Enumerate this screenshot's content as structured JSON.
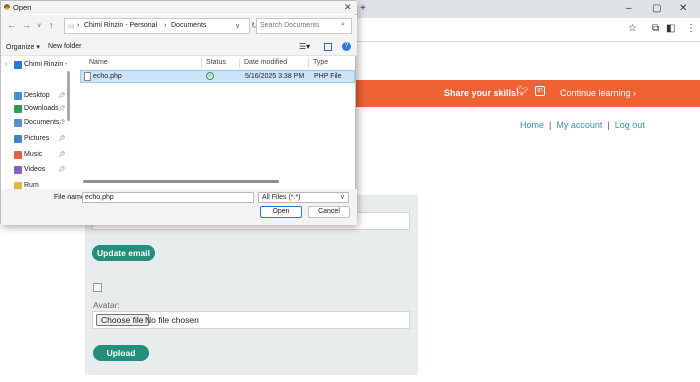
{
  "website": {
    "banner": {
      "text": "Share your skills!",
      "twitter_icon": "twitter-icon",
      "linkedin_icon": "linkedin-icon",
      "linkedin_glyph": "in",
      "continue": "Continue learning ›"
    },
    "nav": {
      "home": "Home",
      "sep": "|",
      "account": "My account",
      "logout": "Log out"
    },
    "update_email_button": "Update email",
    "avatar_label": "Avatar:",
    "choose_file_button": "Choose file",
    "no_file_text": "No file chosen",
    "upload_button": "Upload"
  },
  "dialog": {
    "title": "Open",
    "address": {
      "root": "Chimi Rinzin - Personal",
      "folder": "Documents"
    },
    "search_placeholder": "Search Documents",
    "organize": "Organize ▾",
    "new_folder": "New folder",
    "nav_pane": [
      {
        "label": "Chimi Rinzin - Pe",
        "icon": "cloud-icon",
        "color": "#2a7ad5",
        "pinned": false
      },
      {
        "label": "Desktop",
        "icon": "desktop-icon",
        "color": "#3b8fd6",
        "pinned": true
      },
      {
        "label": "Downloads",
        "icon": "downloads-icon",
        "color": "#2f9a5a",
        "pinned": true
      },
      {
        "label": "Documents",
        "icon": "documents-icon",
        "color": "#5a8fc7",
        "pinned": true
      },
      {
        "label": "Pictures",
        "icon": "pictures-icon",
        "color": "#3f86c9",
        "pinned": true
      },
      {
        "label": "Music",
        "icon": "music-icon",
        "color": "#e0644a",
        "pinned": true
      },
      {
        "label": "Videos",
        "icon": "videos-icon",
        "color": "#8b5cc7",
        "pinned": true
      },
      {
        "label": "Rum",
        "icon": "folder-icon",
        "color": "#e8b640",
        "pinned": false
      }
    ],
    "columns": {
      "name": "Name",
      "status": "Status",
      "date": "Date modified",
      "type": "Type"
    },
    "files": [
      {
        "name": "echo.php",
        "date": "5/16/2025 3:38 PM",
        "type": "PHP File"
      }
    ],
    "file_name_label": "File name:",
    "file_name_value": "echo.php",
    "file_type": "All Files (*.*)",
    "open_button": "Open",
    "cancel_button": "Cancel"
  }
}
